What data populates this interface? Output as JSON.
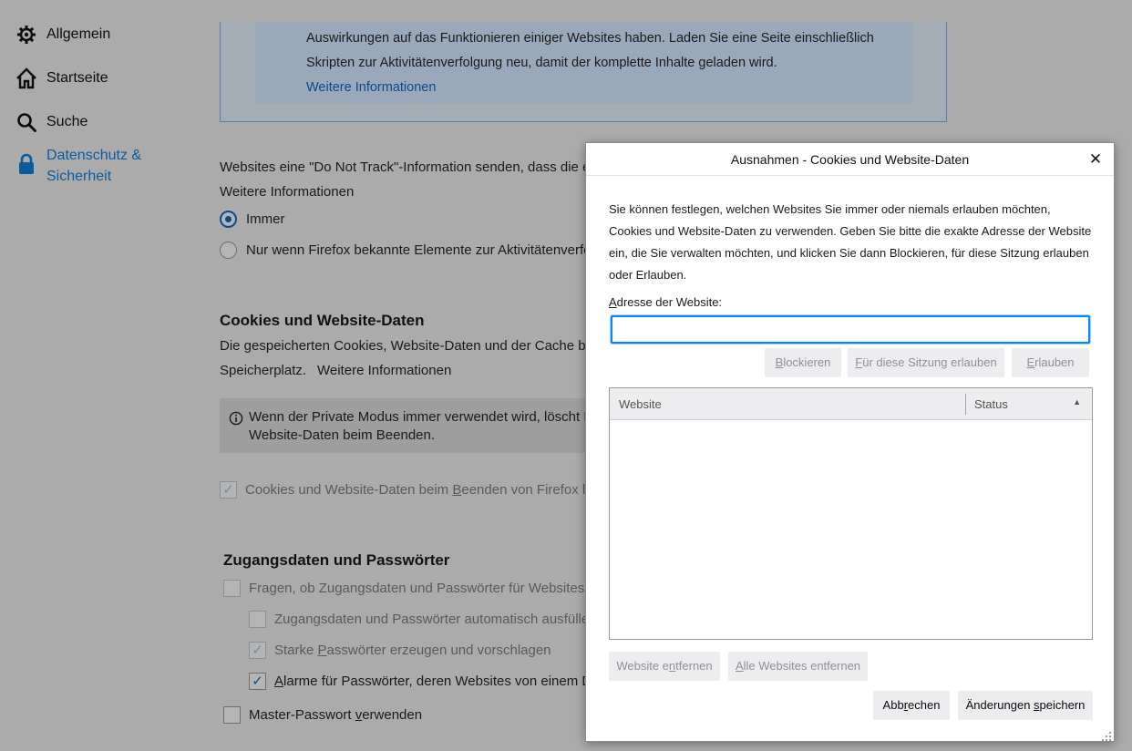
{
  "sidebar": {
    "items": [
      {
        "label": "Allgemein",
        "icon": "gear-icon"
      },
      {
        "label": "Startseite",
        "icon": "home-icon"
      },
      {
        "label": "Suche",
        "icon": "search-icon"
      },
      {
        "label": "Datenschutz &",
        "label2": "Sicherheit",
        "icon": "lock-icon",
        "active": true
      }
    ]
  },
  "tracking_box": {
    "line1": "Auswirkungen auf das Funktionieren einiger Websites haben. Laden Sie eine Seite einschließlich",
    "line2": "Skripten zur Aktivitätenverfolgung neu, damit der komplette Inhalte geladen wird.",
    "link": "Weitere Informationen"
  },
  "dnt": {
    "text": "Websites eine \"Do Not Track\"-Information senden, dass die e",
    "link": "Weitere Informationen",
    "option_always": "Immer",
    "option_known": "Nur wenn Firefox bekannte Elemente zur Aktivitätenverfo"
  },
  "cookies": {
    "heading": "Cookies und Website-Daten",
    "desc1": "Die gespeicherten Cookies, Website-Daten und der Cache be",
    "desc2": "Speicherplatz.",
    "link": "Weitere Informationen",
    "info_line1": "Wenn der Private Modus immer verwendet wird, löscht F",
    "info_line2": "Website-Daten beim Beenden.",
    "delete_on_close_a": "Cookies und Website-Daten beim ",
    "delete_on_close_u": "B",
    "delete_on_close_b": "eenden von Firefox lö"
  },
  "passwords": {
    "heading": "Zugangsdaten und Passwörter",
    "ask_a": "Fragen, ob Zugangsdaten und Passwörter für Websites g",
    "autofill": "Zugangsdaten und Passwörter automatisch ausfüller",
    "strong_a": "Starke ",
    "strong_u": "P",
    "strong_b": "asswörter erzeugen und vorschlagen",
    "alerts_u": "A",
    "alerts_b": "larme für Passwörter, deren Websites von einem Da",
    "master_a": "Master-Passwort ",
    "master_u": "v",
    "master_b": "erwenden"
  },
  "dialog": {
    "title": "Ausnahmen - Cookies und Website-Daten",
    "close": "✕",
    "desc1": "Sie können festlegen, welchen Websites Sie immer oder niemals erlauben möchten,",
    "desc2": "Cookies und Website-Daten zu verwenden. Geben Sie bitte die exakte Adresse der Website",
    "desc3": "ein, die Sie verwalten möchten, und klicken Sie dann Blockieren, für diese Sitzung erlauben",
    "desc4": "oder Erlauben.",
    "address_label_u": "A",
    "address_label_rest": "dresse der Website:",
    "address_value": "",
    "block_u": "B",
    "block_rest": "lockieren",
    "session_u": "F",
    "session_rest": "ür diese Sitzung erlauben",
    "allow_u": "E",
    "allow_rest": "rlauben",
    "col_website": "Website",
    "col_status": "Status",
    "remove_a": "Website e",
    "remove_u": "n",
    "remove_b": "tfernen",
    "remove_all_u": "A",
    "remove_all_b": "lle Websites entfernen",
    "cancel_a": "Abb",
    "cancel_u": "r",
    "cancel_b": "echen",
    "save_a": "Änderungen ",
    "save_u": "s",
    "save_b": "peichern"
  }
}
